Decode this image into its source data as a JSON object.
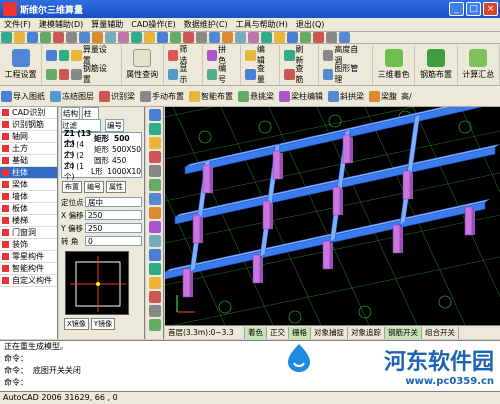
{
  "window": {
    "title": "斯维尔三维算量"
  },
  "menu": [
    "文件(F)",
    "建模辅助(D)",
    "算量辅助",
    "CAD操作(E)",
    "数据维护(C)",
    "工具与帮助(H)",
    "退出(Q)"
  ],
  "toolbar1": {
    "labels": [
      "算量设置",
      "钢筋设置",
      "属性查询",
      "筛选",
      "显示",
      "拼色",
      "编号",
      "编辑",
      "查量",
      "刷新",
      "查筋",
      "高度自调",
      "图形管理",
      "三维着色",
      "钢筋布置",
      "计算汇总"
    ],
    "project_settings": "工程设置"
  },
  "toolbar2": [
    "导入图纸",
    "冻结图层",
    "识别梁",
    "手动布置",
    "智能布置",
    "悬挑梁",
    "梁柱编辑",
    "斜拱梁",
    "梁腹",
    "高/"
  ],
  "leftnav": {
    "items": [
      "CAD识别",
      "识别钢筋",
      "轴网",
      "土方",
      "基础",
      "柱体",
      "梁体",
      "墙体",
      "板体",
      "楼梯",
      "门窗洞",
      "装饰",
      "零星构件",
      "智能构件",
      "自定义构件"
    ]
  },
  "props": {
    "category": "结构",
    "type": "柱",
    "filter_label": "过滤",
    "number_label": "编号",
    "header": {
      "name": "Z1 (13个)",
      "shape": "矩形",
      "size": "500"
    },
    "rows": [
      {
        "name": "Z2 (4个)",
        "shape": "矩形",
        "size": "500X50"
      },
      {
        "name": "Z3 (2个)",
        "shape": "圆形",
        "size": "450"
      },
      {
        "name": "Z4 (1个)",
        "shape": "L形",
        "size": "1000X10"
      }
    ],
    "tabs": [
      "布置",
      "编号",
      "属性"
    ],
    "fields": [
      {
        "label": "定位点",
        "value": "居中"
      },
      {
        "label": "X 偏移",
        "value": "250"
      },
      {
        "label": "Y 偏移",
        "value": "250"
      },
      {
        "label": "转 角",
        "value": "0"
      }
    ],
    "mirror_x": "X镜像",
    "mirror_y": "Y镜像"
  },
  "status_tabs": [
    "首层(3.3m):0~3.3",
    "着色",
    "正交",
    "栅格",
    "对象捕捉",
    "对象追踪",
    "钢筋开关",
    "组合开关"
  ],
  "command": {
    "lines": [
      "正在重生成模型。",
      "命令：",
      "命令：  底图开关关闭",
      "命令："
    ]
  },
  "statusbar": "AutoCAD 2006   31629, 66   , 0",
  "watermark": {
    "name": "河东软件园",
    "url": "www.pc0359.cn"
  },
  "colors": {
    "accent": "#316ac5",
    "viewport_bg": "#000000",
    "beam": "#3a7cf0",
    "column": "#c878e0"
  }
}
